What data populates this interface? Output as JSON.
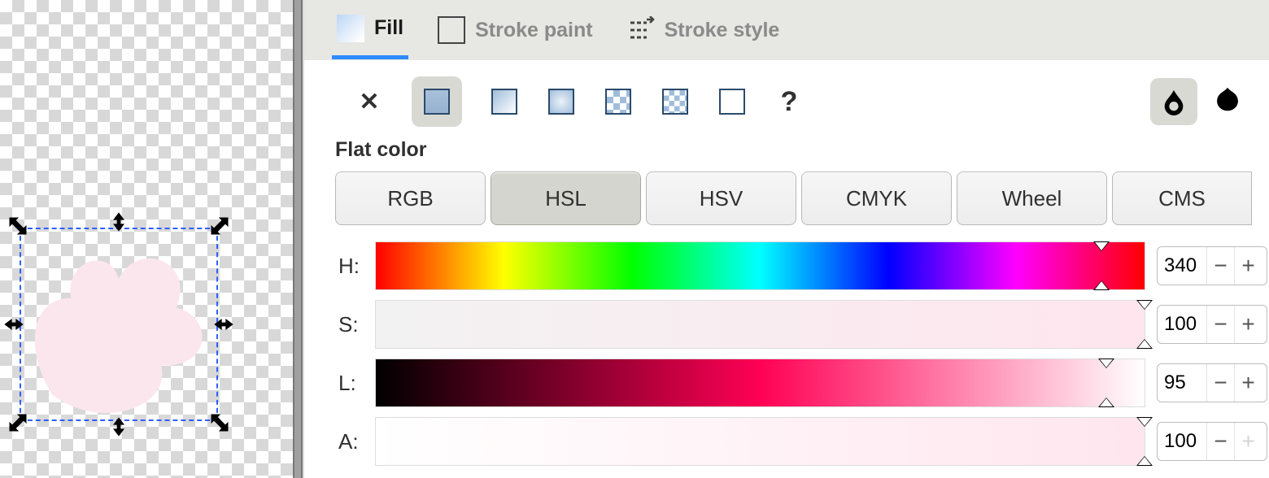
{
  "tabs": {
    "fill": "Fill",
    "stroke_paint": "Stroke paint",
    "stroke_style": "Stroke style",
    "active": "fill"
  },
  "paintTypes": {
    "label": "Flat color",
    "active": "flat"
  },
  "colorModes": {
    "items": [
      "RGB",
      "HSL",
      "HSV",
      "CMYK",
      "Wheel",
      "CMS"
    ],
    "active": "HSL"
  },
  "sliders": {
    "H": {
      "label": "H:",
      "value": 340,
      "pos": 94.4
    },
    "S": {
      "label": "S:",
      "value": 100,
      "pos": 100
    },
    "L": {
      "label": "L:",
      "value": 95,
      "pos": 95
    },
    "A": {
      "label": "A:",
      "value": 100,
      "pos": 100
    }
  },
  "canvas": {
    "selected_fill": "#fce6ee"
  }
}
